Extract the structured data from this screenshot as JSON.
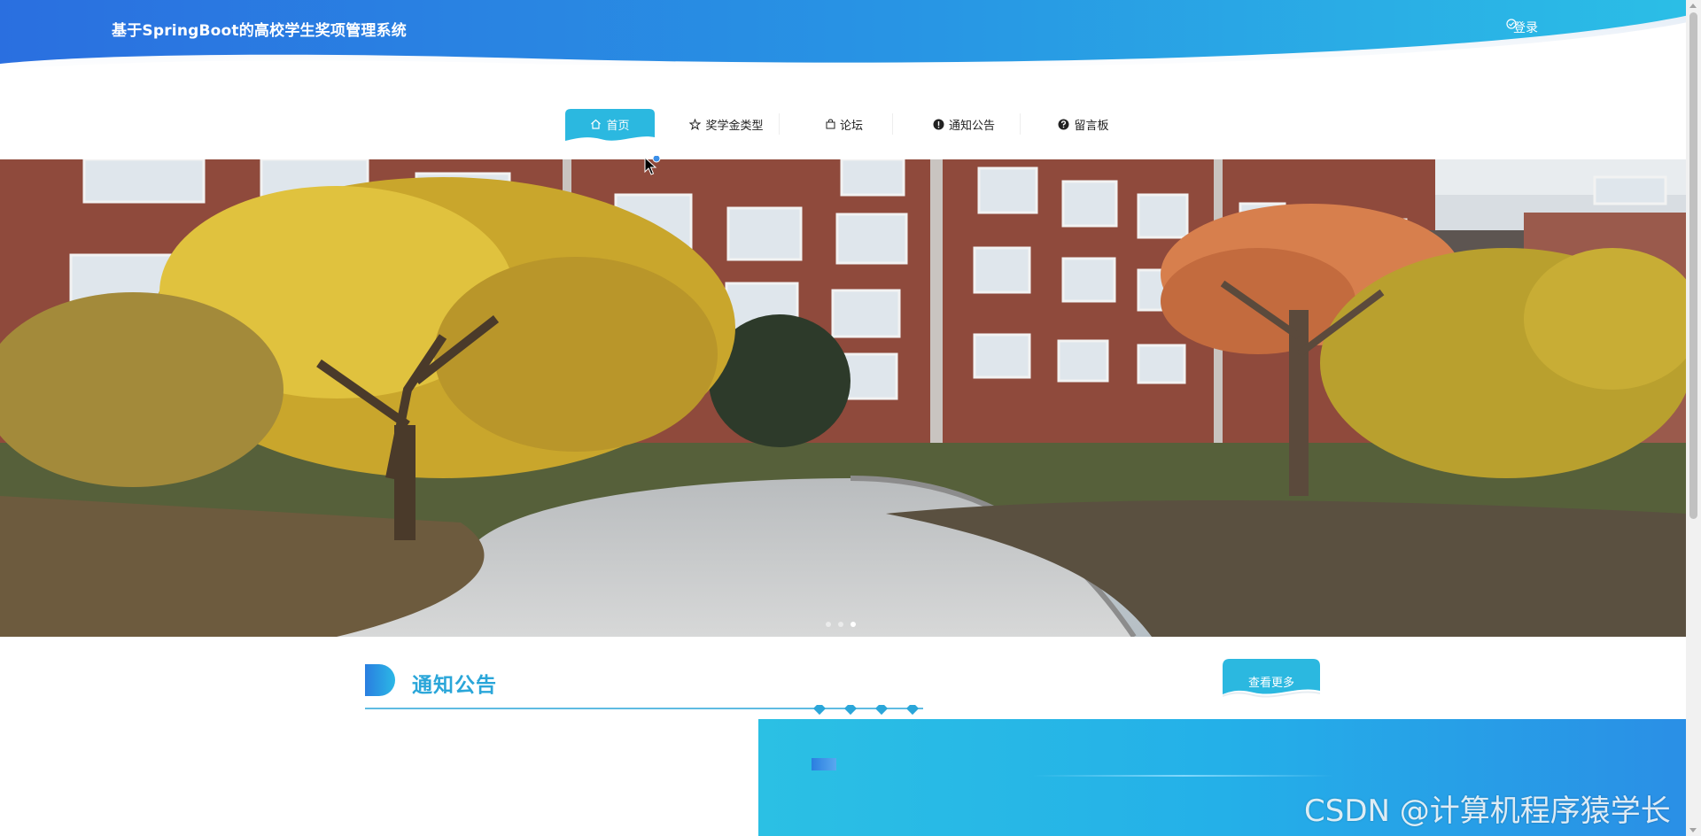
{
  "header": {
    "site_title": "基于SpringBoot的高校学生奖项管理系统",
    "login_label": "登录",
    "login_icon": "check-circle-icon",
    "gradient_start": "#2a6fe0",
    "gradient_end": "#2bbfe6"
  },
  "nav": {
    "items": [
      {
        "label": "首页",
        "icon": "home-icon",
        "active": true
      },
      {
        "label": "奖学金类型",
        "icon": "star-icon",
        "active": false
      },
      {
        "label": "论坛",
        "icon": "bag-icon",
        "active": false
      },
      {
        "label": "通知公告",
        "icon": "exclamation-circle-icon",
        "active": false
      },
      {
        "label": "留言板",
        "icon": "question-circle-icon",
        "active": false
      }
    ],
    "active_color": "#2bb8e0"
  },
  "carousel": {
    "slide_count": 3,
    "active_index": 2
  },
  "notice": {
    "title": "通知公告",
    "more_label": "查看更多",
    "accent_color": "#2aa6d9"
  },
  "watermark": {
    "text": "CSDN @计算机程序猿学长"
  }
}
